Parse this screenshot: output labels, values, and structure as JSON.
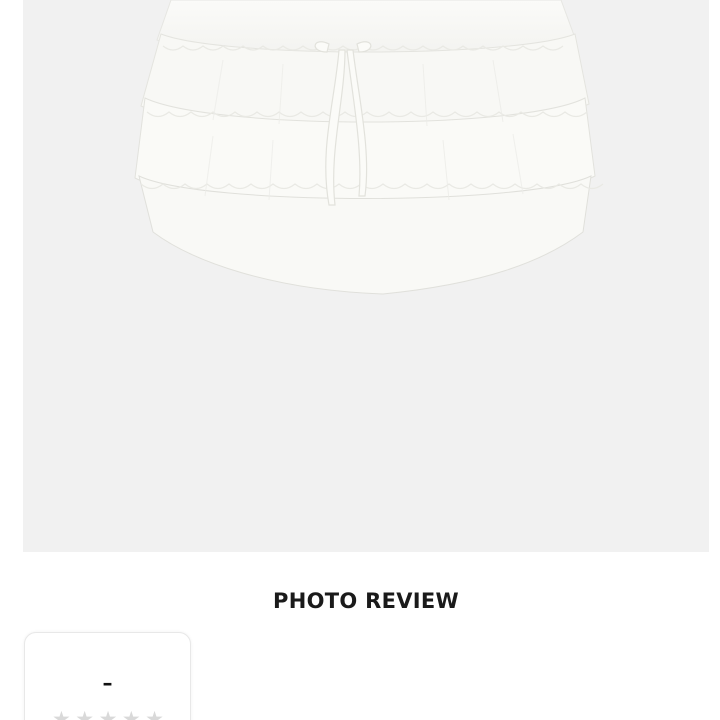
{
  "section": {
    "title": "PHOTO REVIEW"
  },
  "review_summary": {
    "rating_value": "–",
    "stars": [
      {
        "icon": "star-icon",
        "filled": false
      },
      {
        "icon": "star-icon",
        "filled": false
      },
      {
        "icon": "star-icon",
        "filled": false
      },
      {
        "icon": "star-icon",
        "filled": false
      },
      {
        "icon": "star-icon",
        "filled": false
      }
    ],
    "star_empty_color": "#d9d9d9"
  },
  "product_image": {
    "background_color": "#f1f1f1",
    "subject": "white tiered lace ruffle mini skirt"
  }
}
